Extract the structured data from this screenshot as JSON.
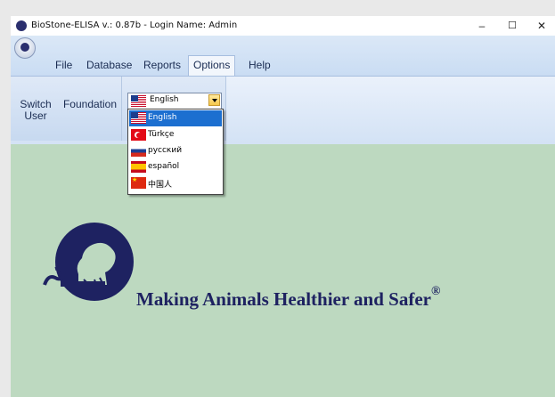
{
  "window": {
    "title": "BioStone-ELISA v.: 0.87b - Login Name: Admin",
    "minimize": "–",
    "maximize": "☐",
    "close": "✕"
  },
  "menu": {
    "items": [
      {
        "label": "File"
      },
      {
        "label": "Database"
      },
      {
        "label": "Reports"
      },
      {
        "label": "Options",
        "active": true
      },
      {
        "label": "Help"
      }
    ]
  },
  "ribbon": {
    "switch_user": "Switch User",
    "foundation": "Foundation"
  },
  "language": {
    "selected": "English",
    "options": [
      {
        "label": "English",
        "flag": "us-flag-icon",
        "selected": true
      },
      {
        "label": "Türkçe",
        "flag": "turkey-flag-icon"
      },
      {
        "label": "русский",
        "flag": "russia-flag-icon"
      },
      {
        "label": "español",
        "flag": "spain-flag-icon"
      },
      {
        "label": "中国人",
        "flag": "china-flag-icon"
      }
    ]
  },
  "main": {
    "tagline": "Making Animals Healthier and Safer",
    "registered": "®"
  },
  "colors": {
    "background": "#bdd9c0",
    "brand": "#1e2261",
    "selection": "#1c6fd0"
  }
}
